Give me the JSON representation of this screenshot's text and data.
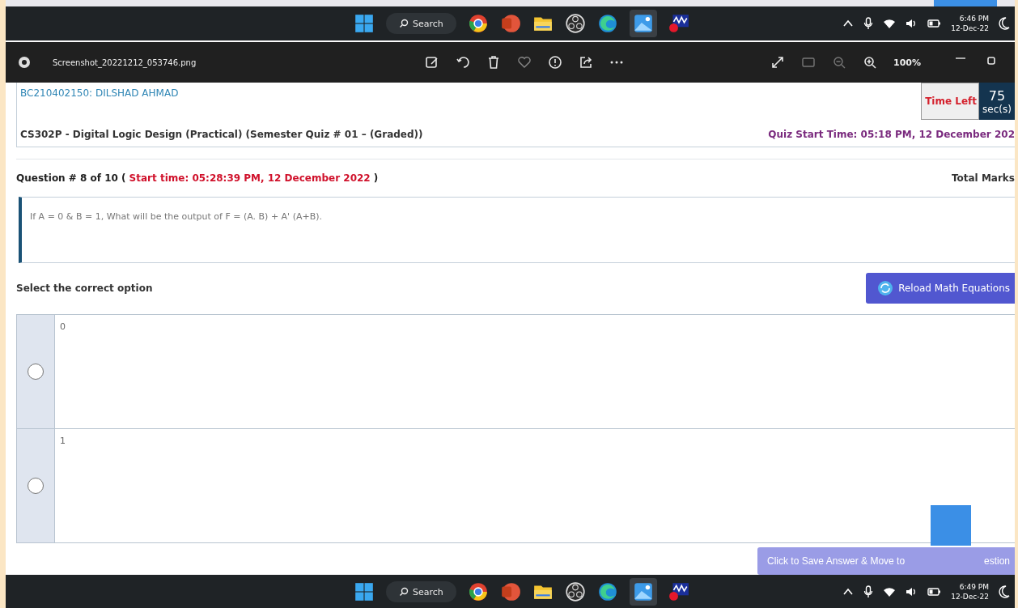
{
  "top_taskbar": {
    "search": "Search",
    "clock_time": "6:46 PM",
    "clock_date": "12-Dec-22"
  },
  "viewer": {
    "file_name": "Screenshot_20221212_053746.png",
    "zoom": "100%"
  },
  "quiz": {
    "student": "BC210402150: DILSHAD AHMAD",
    "course": "CS302P - Digital Logic Design (Practical) (Semester Quiz # 01 – (Graded))",
    "time_left_label": "Time Left",
    "time_left_value": "75",
    "time_left_unit": "sec(s)",
    "quiz_start": "Quiz Start Time: 05:18 PM, 12 December 202",
    "question_number": "Question # 8 of 10 (",
    "question_start": "Start time: 05:28:39 PM, 12 December 2022",
    "question_close": ")",
    "total_marks": "Total Marks",
    "question_text": "If A = 0 & B = 1, What will be the output of F = (A. B) + A' (A+B).",
    "select_prompt": "Select the correct option",
    "reload_button": "Reload Math Equations",
    "options": [
      {
        "label": "0",
        "selected": false
      },
      {
        "label": "1",
        "selected": false
      }
    ],
    "save_button": "Click to Save Answer & Move to",
    "save_button_tail": "estion"
  },
  "bottom_taskbar": {
    "search": "Search",
    "clock_time": "6:49 PM",
    "clock_date": "12-Dec-22"
  }
}
